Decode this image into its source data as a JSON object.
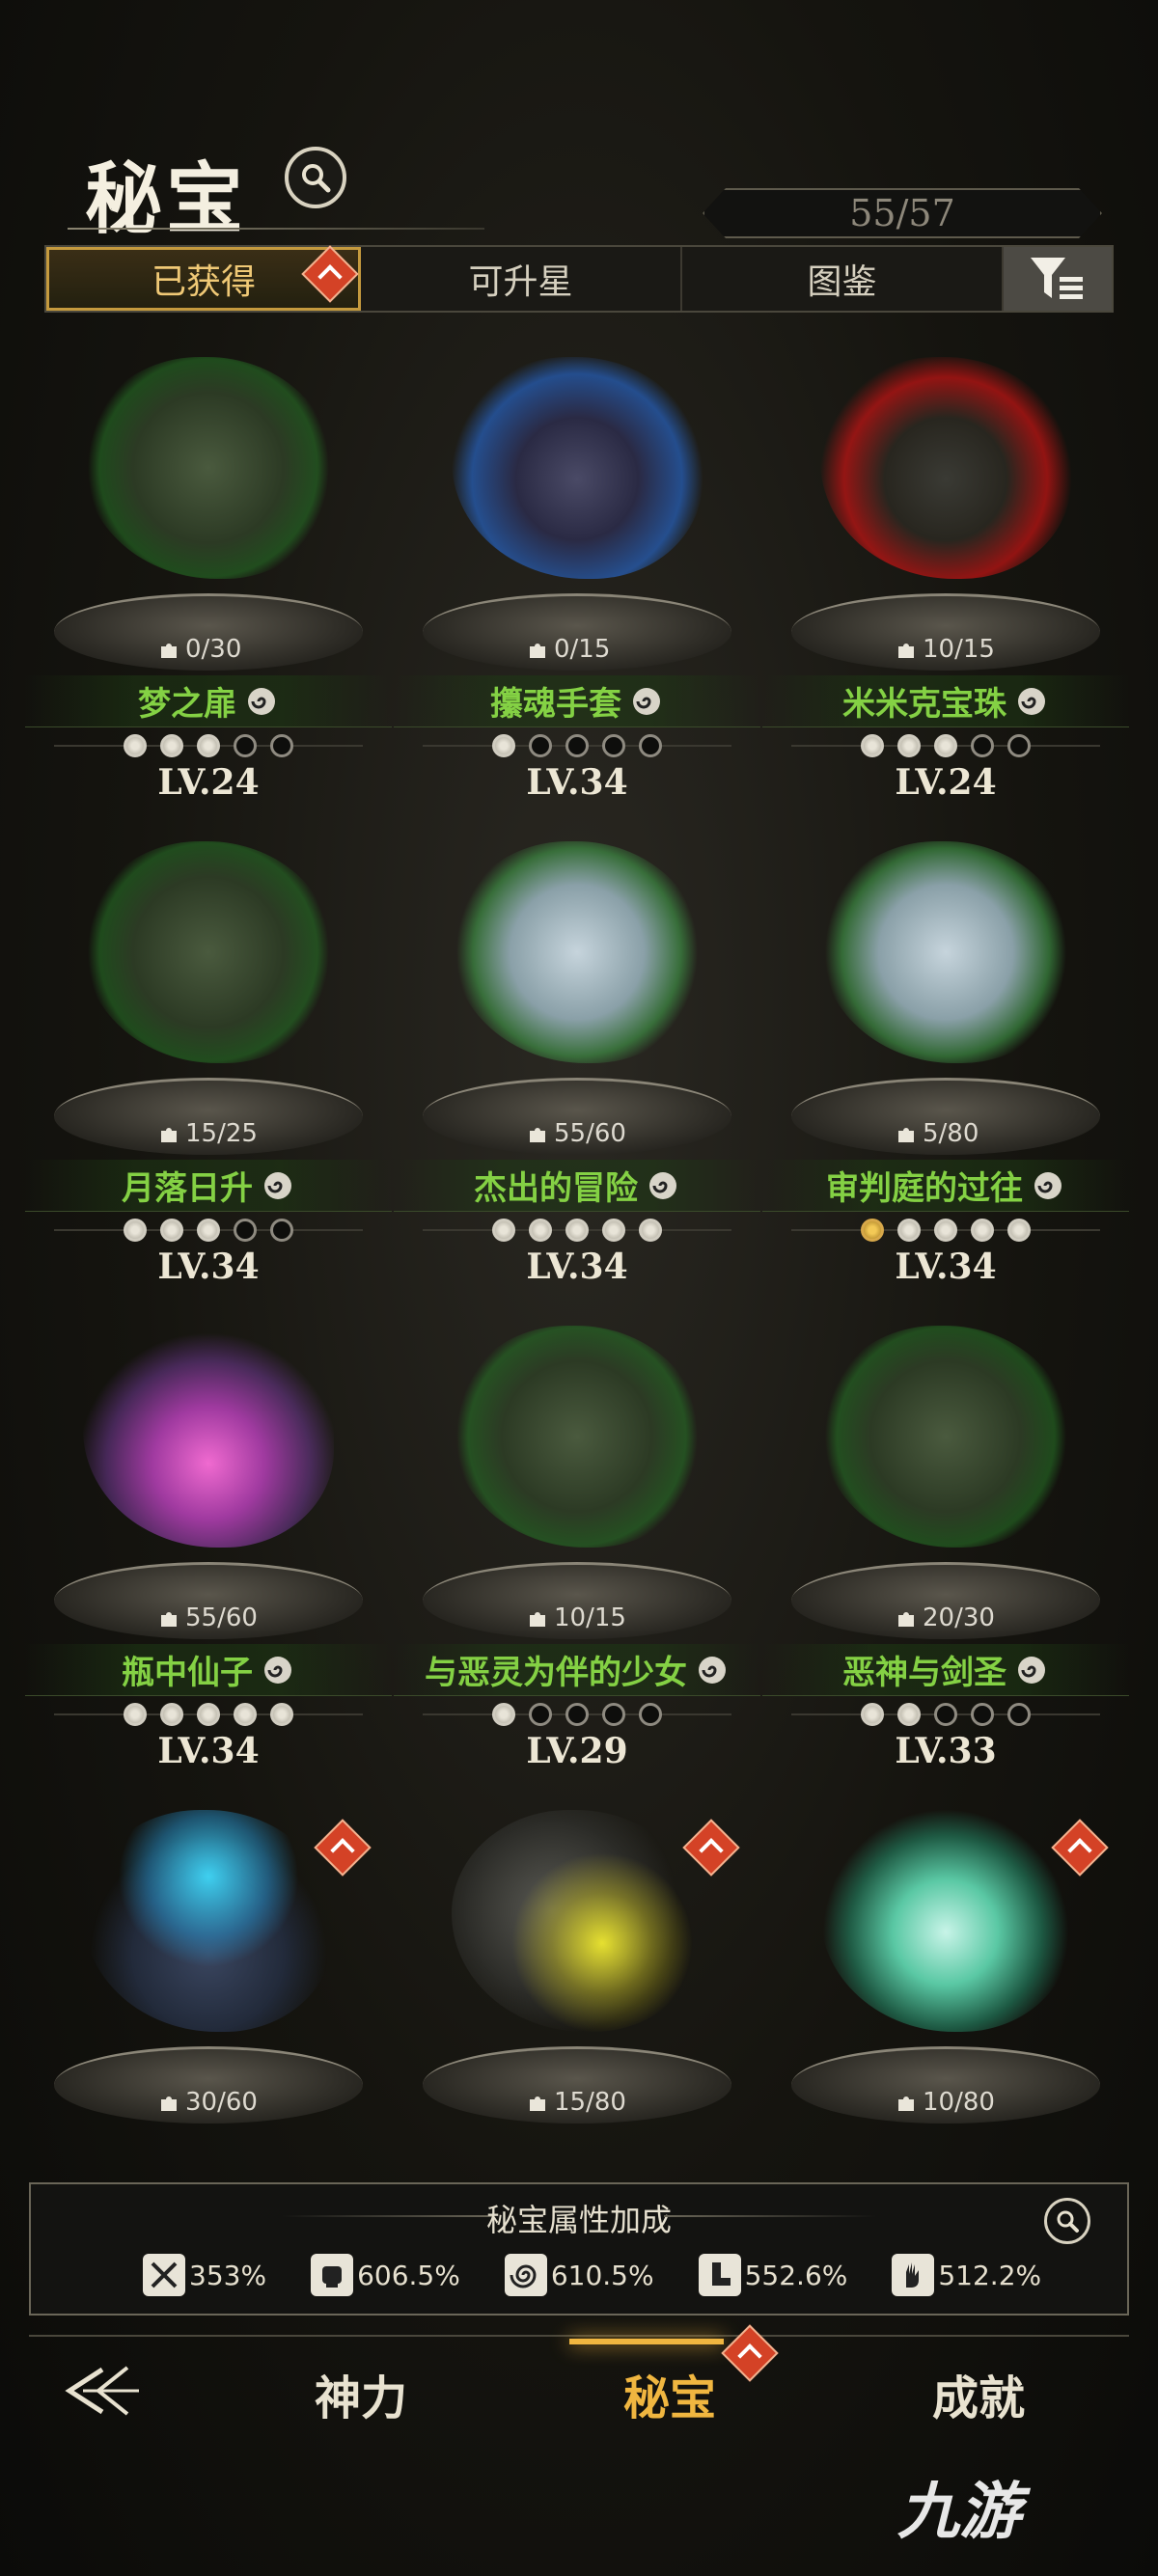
{
  "header": {
    "title": "秘宝",
    "counter": "55/57"
  },
  "tabs": [
    {
      "label": "已获得"
    },
    {
      "label": "可升星"
    },
    {
      "label": "图鉴"
    }
  ],
  "cards": [
    {
      "name": "梦之扉",
      "shards": "0/30",
      "level": "LV.24",
      "stars_on": 3,
      "art": "a-green"
    },
    {
      "name": "攥魂手套",
      "shards": "0/15",
      "level": "LV.34",
      "stars_on": 1,
      "art": "a-blue"
    },
    {
      "name": "米米克宝珠",
      "shards": "10/15",
      "level": "LV.24",
      "stars_on": 3,
      "art": "a-red"
    },
    {
      "name": "月落日升",
      "shards": "15/25",
      "level": "LV.34",
      "stars_on": 3,
      "art": "a-green"
    },
    {
      "name": "杰出的冒险",
      "shards": "55/60",
      "level": "LV.34",
      "stars_on": 5,
      "art": "a-light"
    },
    {
      "name": "审判庭的过往",
      "shards": "5/80",
      "level": "LV.34",
      "stars_on": 5,
      "art": "a-light"
    },
    {
      "name": "瓶中仙子",
      "shards": "55/60",
      "level": "LV.34",
      "stars_on": 5,
      "art": "a-pink"
    },
    {
      "name": "与恶灵为伴的少女",
      "shards": "10/15",
      "level": "LV.29",
      "stars_on": 1,
      "art": "a-green"
    },
    {
      "name": "恶神与剑圣",
      "shards": "20/30",
      "level": "LV.33",
      "stars_on": 2,
      "art": "a-green"
    },
    {
      "name": "",
      "shards": "30/60",
      "level": "",
      "stars_on": 0,
      "art": "a-pot"
    },
    {
      "name": "",
      "shards": "15/80",
      "level": "",
      "stars_on": 0,
      "art": "a-gaunt"
    },
    {
      "name": "",
      "shards": "10/80",
      "level": "",
      "stars_on": 0,
      "art": "a-lotus"
    }
  ],
  "bonus": {
    "title": "秘宝属性加成",
    "stats": [
      {
        "icon": "sword-icon",
        "value": "353%"
      },
      {
        "icon": "fist-icon",
        "value": "606.5%"
      },
      {
        "icon": "swirl-icon",
        "value": "610.5%"
      },
      {
        "icon": "boot-icon",
        "value": "552.6%"
      },
      {
        "icon": "hand-icon",
        "value": "512.2%"
      }
    ]
  },
  "nav": {
    "item1": "神力",
    "item2": "秘宝",
    "item3": "成就"
  },
  "watermark": "九游"
}
